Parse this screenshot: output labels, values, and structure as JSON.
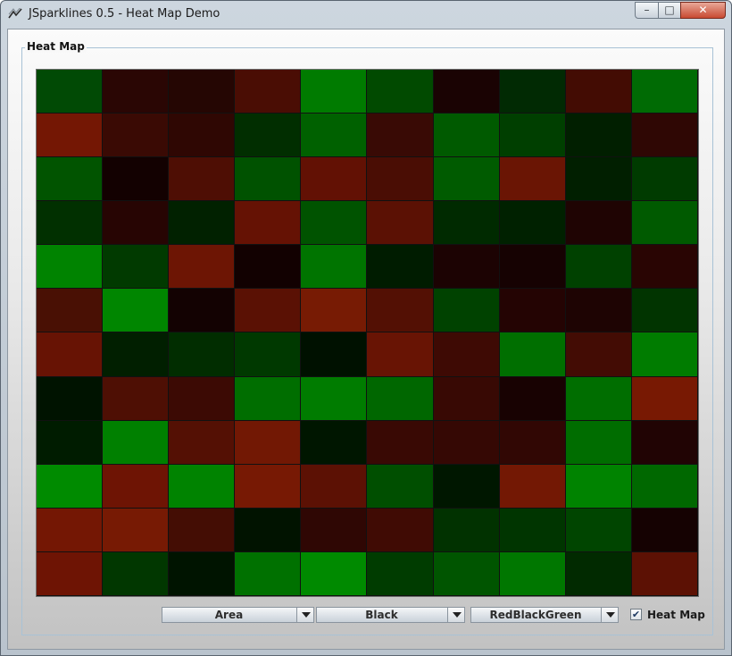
{
  "window": {
    "title": "JSparklines 0.5 - Heat Map Demo",
    "minimize_glyph": "–",
    "maximize_glyph": "□",
    "close_glyph": "✕"
  },
  "panel": {
    "title": "Heat Map"
  },
  "heatmap": {
    "color_scheme": "RedBlackGreen",
    "grid": {
      "rows": 12,
      "columns": 10
    },
    "colors": [
      [
        "#014a05",
        "#2a0604",
        "#250603",
        "#4a0d04",
        "#007b00",
        "#014a00",
        "#1a0303",
        "#012a03",
        "#430c03",
        "#006b04"
      ],
      [
        "#741704",
        "#3a0a04",
        "#2f0703",
        "#012e00",
        "#006100",
        "#390a05",
        "#005a00",
        "#003f00",
        "#011f00",
        "#2f0704"
      ],
      [
        "#015400",
        "#130101",
        "#4e0e04",
        "#005200",
        "#621104",
        "#4a0d04",
        "#005b00",
        "#6a1504",
        "#011f00",
        "#003b00"
      ],
      [
        "#013000",
        "#270503",
        "#012100",
        "#651204",
        "#005300",
        "#5b1104",
        "#002a00",
        "#002100",
        "#1f0403",
        "#005a00"
      ],
      [
        "#008300",
        "#013a00",
        "#6d1504",
        "#120101",
        "#007400",
        "#001c00",
        "#1c0303",
        "#160202",
        "#004100",
        "#290503"
      ],
      [
        "#491004",
        "#008600",
        "#130202",
        "#5a1104",
        "#771b04",
        "#531004",
        "#004200",
        "#240403",
        "#1e0403",
        "#013400"
      ],
      [
        "#671304",
        "#011f00",
        "#012d00",
        "#003900",
        "#001100",
        "#681404",
        "#3e0a04",
        "#006f00",
        "#430c04",
        "#007c00"
      ],
      [
        "#001300",
        "#4e0f04",
        "#3c0a04",
        "#006e00",
        "#007c00",
        "#006700",
        "#380904",
        "#180202",
        "#006e00",
        "#781903"
      ],
      [
        "#001c00",
        "#008000",
        "#541004",
        "#721804",
        "#001600",
        "#390904",
        "#350804",
        "#310704",
        "#006d00",
        "#210404"
      ],
      [
        "#008b00",
        "#6e1404",
        "#008300",
        "#771904",
        "#5c1104",
        "#004f00",
        "#001700",
        "#731804",
        "#008300",
        "#006800"
      ],
      [
        "#741704",
        "#771a04",
        "#440d04",
        "#011300",
        "#2f0704",
        "#400b04",
        "#013200",
        "#003500",
        "#004500",
        "#150202"
      ],
      [
        "#6e1404",
        "#013700",
        "#001400",
        "#007100",
        "#008a00",
        "#003c00",
        "#005500",
        "#007700",
        "#012a00",
        "#5c1104"
      ]
    ]
  },
  "controls": {
    "value_type": {
      "selected": "Area"
    },
    "background": {
      "selected": "Black"
    },
    "color_scheme": {
      "selected": "RedBlackGreen"
    },
    "heat_map_toggle": {
      "label": "Heat Map",
      "checked": true,
      "check_glyph": "✔"
    }
  }
}
